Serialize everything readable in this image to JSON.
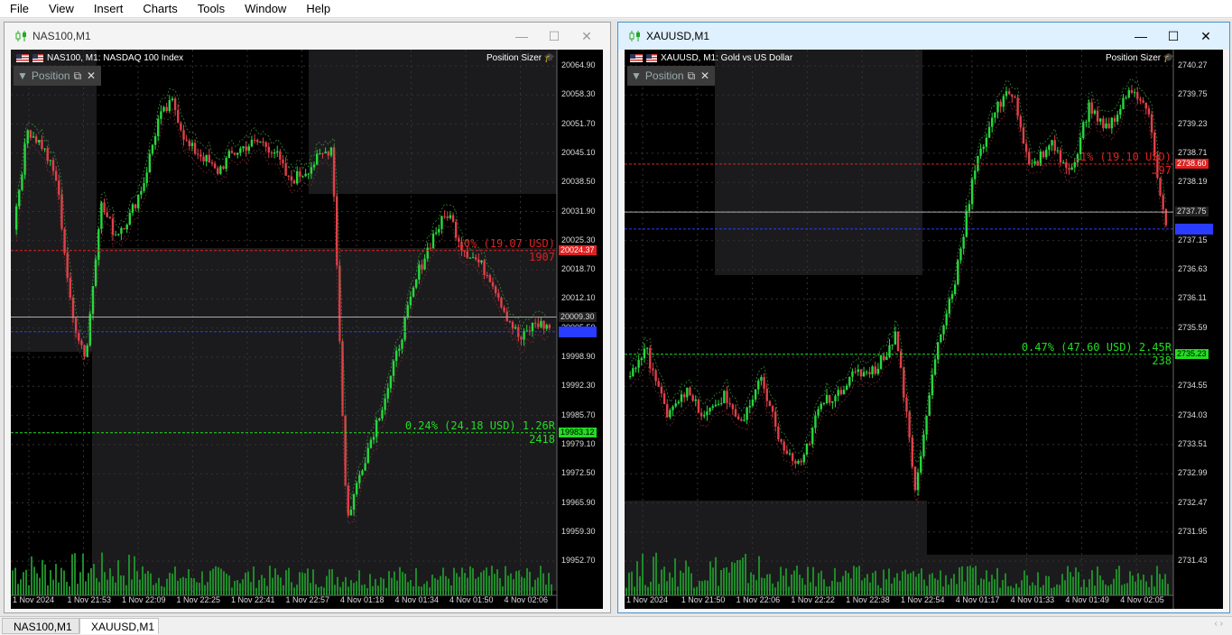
{
  "menu": [
    "File",
    "View",
    "Insert",
    "Charts",
    "Tools",
    "Window",
    "Help"
  ],
  "colors": {
    "bull": "#27d83f",
    "bear": "#e0404a",
    "sl": "#e02020",
    "tp": "#22dd22",
    "entry": "#2a3cff",
    "panel": "#1b1b1d"
  },
  "windows": [
    {
      "title": "NAS100,M1",
      "active": false,
      "header": "NAS100, M1:  NASDAQ 100 Index",
      "position_sizer": "Position Sizer",
      "panel_title": "Position",
      "y_ticks": [
        "20064.90",
        "20058.30",
        "20051.70",
        "20045.10",
        "20038.50",
        "20031.90",
        "20025.30",
        "20018.70",
        "20012.10",
        "20005.50",
        "19998.90",
        "19992.30",
        "19985.70",
        "19979.10",
        "19972.50",
        "19965.90",
        "19959.30",
        "19952.70"
      ],
      "x_ticks": [
        "1 Nov 2024",
        "1 Nov 21:53",
        "1 Nov 22:09",
        "1 Nov 22:25",
        "1 Nov 22:41",
        "1 Nov 22:57",
        "4 Nov 01:18",
        "4 Nov 01:34",
        "4 Nov 01:50",
        "4 Nov 02:06"
      ],
      "sl_text": "…0% (19.07 USD)",
      "sl_sub": "1907",
      "sl_price": "20024.37",
      "tp_text": "0.24% (24.18 USD) 1.26R",
      "tp_sub": "2418",
      "tp_price": "19983.12",
      "cur_price": "20009.30",
      "entry_price": "20006.00",
      "ylim": [
        19949.4,
        20068.2
      ],
      "series": [
        20030,
        20052,
        20048,
        20040,
        20010,
        20000,
        20035,
        20028,
        20032,
        20040,
        20054,
        20058,
        20048,
        20046,
        20042,
        20046,
        20048,
        20049,
        20047,
        20040,
        20042,
        20045,
        20048,
        19963,
        19975,
        19985,
        19995,
        20008,
        20020,
        20028,
        20033,
        20025,
        20022,
        20018,
        20010,
        20004,
        20008,
        20007
      ]
    },
    {
      "title": "XAUUSD,M1",
      "active": true,
      "header": "XAUUSD, M1:  Gold vs US Dollar",
      "position_sizer": "Position Sizer",
      "panel_title": "Position",
      "y_ticks": [
        "2740.27",
        "2739.75",
        "2739.23",
        "2738.71",
        "2738.19",
        "2737.67",
        "2737.15",
        "2736.63",
        "2736.11",
        "2735.59",
        "2735.07",
        "2734.55",
        "2734.03",
        "2733.51",
        "2732.99",
        "2732.47",
        "2731.95",
        "2731.43"
      ],
      "x_ticks": [
        "1 Nov 2024",
        "1 Nov 21:50",
        "1 Nov 22:06",
        "1 Nov 22:22",
        "1 Nov 22:38",
        "1 Nov 22:54",
        "4 Nov 01:17",
        "4 Nov 01:33",
        "4 Nov 01:49",
        "4 Nov 02:05"
      ],
      "sl_text": "…1% (19.10 USD)",
      "sl_sub": "…97",
      "sl_price": "2738.60",
      "tp_text": "0.47% (47.60 USD) 2.45R",
      "tp_sub": "238",
      "tp_price": "2735.23",
      "cur_price": "2737.75",
      "entry_price": "2737.45",
      "ylim": [
        2731.2,
        2740.5
      ],
      "series": [
        2734.8,
        2735.3,
        2734.2,
        2734.6,
        2734.1,
        2734.5,
        2734.0,
        2734.8,
        2733.6,
        2733.2,
        2734.3,
        2734.6,
        2734.9,
        2735.0,
        2735.6,
        2732.8,
        2735.2,
        2736.5,
        2738.4,
        2739.5,
        2739.9,
        2738.5,
        2739.0,
        2738.4,
        2739.6,
        2739.2,
        2739.9,
        2739.6,
        2737.5
      ]
    }
  ],
  "tabs": [
    "NAS100,M1",
    "XAUUSD,M1"
  ],
  "scroll_arrows": "‹  ›"
}
